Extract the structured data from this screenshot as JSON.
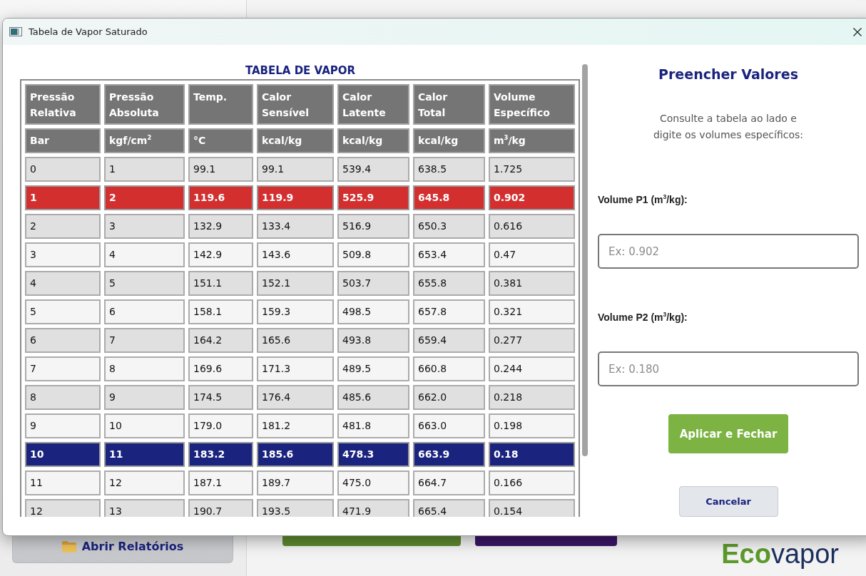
{
  "background_app": {
    "sidebar_button": {
      "label": "Abrir Relatórios"
    },
    "buttons": [
      {
        "color": "#5e8a30"
      },
      {
        "color": "#3b1567"
      }
    ],
    "logo": {
      "parts": [
        {
          "text": "Eco",
          "color": "#5c9a2b"
        },
        {
          "text": "vapor",
          "color": "#1b2f5e"
        }
      ]
    }
  },
  "window": {
    "title": "Tabela de Vapor Saturado"
  },
  "table": {
    "title": "TABELA DE VAPOR",
    "columns": [
      {
        "label": "Pressão Relativa",
        "unit": "Bar"
      },
      {
        "label": "Pressão Absoluta",
        "unit": "kgf/cm$^{2}$"
      },
      {
        "label": "Temp.",
        "unit": "°C"
      },
      {
        "label": "Calor Sensível",
        "unit": "kcal/kg"
      },
      {
        "label": "Calor Latente",
        "unit": "kcal/kg"
      },
      {
        "label": "Calor Total",
        "unit": "kcal/kg"
      },
      {
        "label": "Volume Específico",
        "unit": "m$^{3}$/kg"
      }
    ],
    "rows": [
      {
        "cells": [
          "0",
          "1",
          "99.1",
          "99.1",
          "539.4",
          "638.5",
          "1.725"
        ]
      },
      {
        "cells": [
          "1",
          "2",
          "119.6",
          "119.9",
          "525.9",
          "645.8",
          "0.902"
        ],
        "color": "#d32f2f"
      },
      {
        "cells": [
          "2",
          "3",
          "132.9",
          "133.4",
          "516.9",
          "650.3",
          "0.616"
        ]
      },
      {
        "cells": [
          "3",
          "4",
          "142.9",
          "143.6",
          "509.8",
          "653.4",
          "0.47"
        ]
      },
      {
        "cells": [
          "4",
          "5",
          "151.1",
          "152.1",
          "503.7",
          "655.8",
          "0.381"
        ]
      },
      {
        "cells": [
          "5",
          "6",
          "158.1",
          "159.3",
          "498.5",
          "657.8",
          "0.321"
        ]
      },
      {
        "cells": [
          "6",
          "7",
          "164.2",
          "165.6",
          "493.8",
          "659.4",
          "0.277"
        ]
      },
      {
        "cells": [
          "7",
          "8",
          "169.6",
          "171.3",
          "489.5",
          "660.8",
          "0.244"
        ]
      },
      {
        "cells": [
          "8",
          "9",
          "174.5",
          "176.4",
          "485.6",
          "662.0",
          "0.218"
        ]
      },
      {
        "cells": [
          "9",
          "10",
          "179.0",
          "181.2",
          "481.8",
          "663.0",
          "0.198"
        ]
      },
      {
        "cells": [
          "10",
          "11",
          "183.2",
          "185.6",
          "478.3",
          "663.9",
          "0.18"
        ],
        "color": "#1a237e"
      },
      {
        "cells": [
          "11",
          "12",
          "187.1",
          "189.7",
          "475.0",
          "664.7",
          "0.166"
        ]
      },
      {
        "cells": [
          "12",
          "13",
          "190.7",
          "193.5",
          "471.9",
          "665.4",
          "0.154"
        ]
      }
    ]
  },
  "form": {
    "title": "Preencher Valores",
    "instructions": "Consulte a tabela ao lado e digite os volumes específicos:",
    "fields": [
      {
        "label": "Volume P1 (m$^{3}$/kg):",
        "placeholder": "Ex: 0.902"
      },
      {
        "label": "Volume P2 (m$^{3}$/kg):",
        "placeholder": "Ex: 0.180"
      }
    ],
    "buttons": [
      {
        "label": "Aplicar e Fechar",
        "kind": "primary"
      },
      {
        "label": "Cancelar",
        "kind": "secondary"
      }
    ]
  }
}
